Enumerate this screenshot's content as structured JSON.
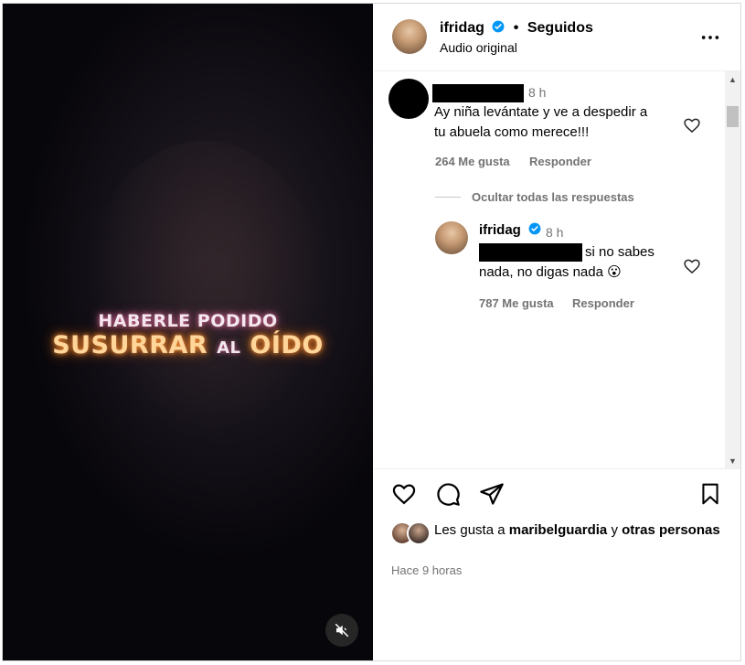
{
  "video": {
    "caption_line1": "HABERLE PODIDO",
    "caption_line2_a": "SUSURRAR",
    "caption_line2_b": "AL",
    "caption_line2_c": "OÍDO",
    "mute_icon": "speaker-muted-icon"
  },
  "header": {
    "username": "ifridag",
    "verified_icon": "verified-badge-icon",
    "separator": "•",
    "follow_status": "Seguidos",
    "audio_label": "Audio original",
    "more_icon": "more-horizontal-icon"
  },
  "comments": [
    {
      "username_redacted": true,
      "time": "8 h",
      "text_line1": "Ay niña levántate y ve a despedir a",
      "text_line2": "tu abuela como merece!!!",
      "likes": "264 Me gusta",
      "reply_label": "Responder"
    }
  ],
  "hide_replies": "Ocultar todas las respuestas",
  "reply": {
    "username": "ifridag",
    "time": "8 h",
    "text_line1": "si no sabes",
    "text_line2": "nada, no digas nada 😮",
    "likes": "787 Me gusta",
    "reply_label": "Responder"
  },
  "actions": {
    "like_icon": "heart-icon",
    "comment_icon": "comment-icon",
    "share_icon": "send-icon",
    "save_icon": "bookmark-icon"
  },
  "likes_summary": {
    "prefix": "Les gusta a",
    "user": "maribelguardia",
    "conj": "y",
    "others": "otras personas"
  },
  "posted_ago": "Hace 9 horas",
  "colors": {
    "verified": "#0095f6",
    "muted_text": "#737373",
    "border": "#efefef"
  }
}
